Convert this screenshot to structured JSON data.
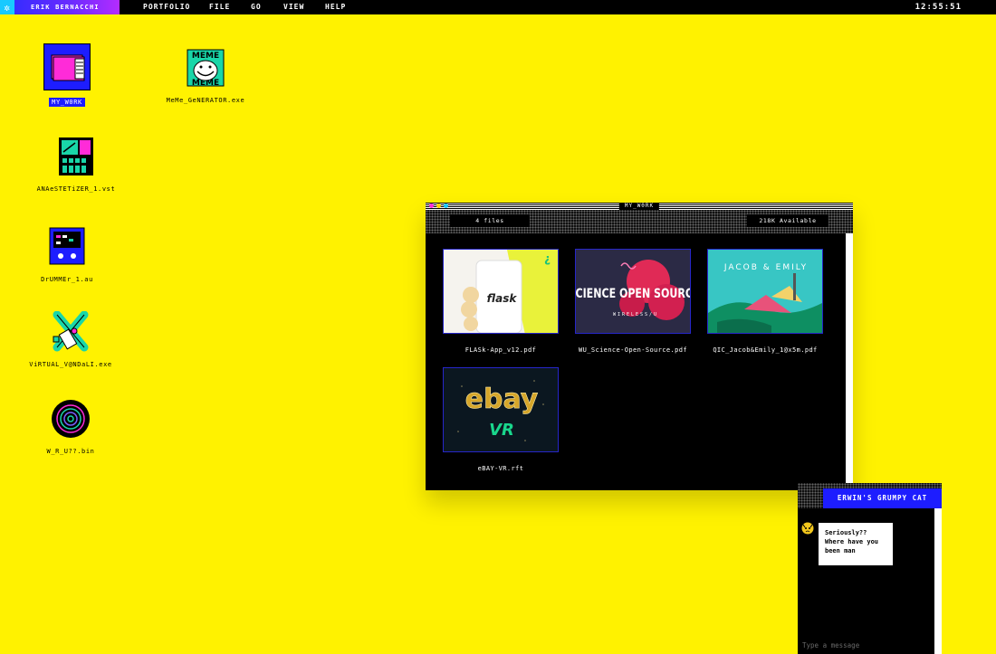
{
  "menubar": {
    "brand": "ERIK BERNACCHI",
    "items": [
      "PORTFOLIO",
      "FILE",
      "GO",
      "VIEW",
      "HELP"
    ],
    "clock": "12:55:51"
  },
  "desktop_icons": [
    {
      "label": "MY_W0RK",
      "icon": "folder-icon",
      "selected": true
    },
    {
      "label": "MeMe_GeNERATOR.exe",
      "icon": "meme-generator-icon"
    },
    {
      "label": "ANAeSTETiZER_1.vst",
      "icon": "synth-plugin-icon"
    },
    {
      "label": "DrUMMEr_1.au",
      "icon": "drum-machine-icon"
    },
    {
      "label": "ViRTUAL_V@NDaLI.exe",
      "icon": "spray-can-icon"
    },
    {
      "label": "W_R_U??.bin",
      "icon": "spiral-disc-icon"
    }
  ],
  "window": {
    "title": "MY_W0RK",
    "file_count": "4 files",
    "available": "218K Available",
    "files": [
      {
        "name": "FLASk-App_v12.pdf",
        "thumb_text": "flask"
      },
      {
        "name": "WU_Science-Open-Source.pdf",
        "thumb_text": "SCIENCE OPEN SOURCE",
        "thumb_sub": "WIRELESS/U"
      },
      {
        "name": "QIC_Jacob&Emily_1@x5m.pdf",
        "thumb_text": "JACOB & EMILY"
      },
      {
        "name": "eBAY-VR.rft",
        "thumb_text": "ebay",
        "thumb_sub": "VR"
      }
    ]
  },
  "chat": {
    "title": "ERWIN'S GRUMPY CAT",
    "message": "Seriously?? Where have you been man",
    "input_placeholder": "Type a message"
  },
  "colors": {
    "desktop": "#FFF200",
    "accent_blue": "#1D1DFF",
    "window_bg": "#000000"
  }
}
